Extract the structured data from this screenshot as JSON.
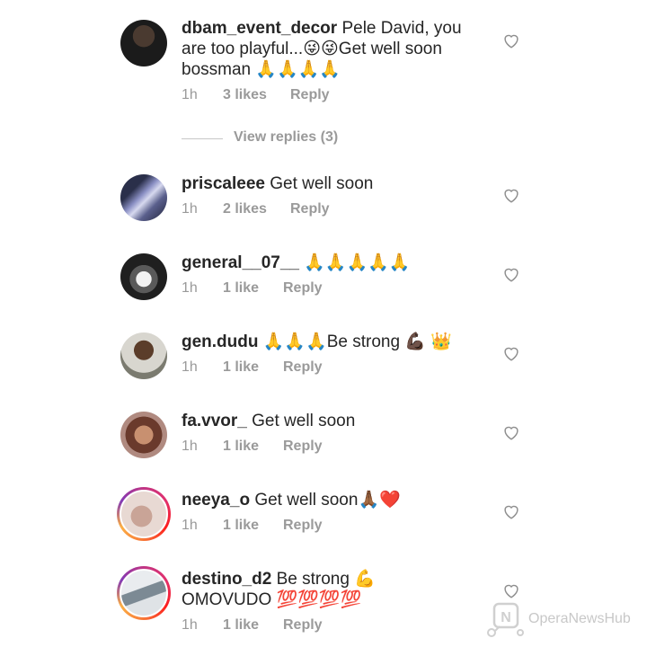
{
  "comments": [
    {
      "username": "dbam_event_decor",
      "text": " Pele David, you are too playful...😜😜Get well soon bossman 🙏🙏🙏🙏",
      "time": "1h",
      "likes": "3 likes",
      "reply": "Reply",
      "view_replies": "View replies (3)"
    },
    {
      "username": "priscaleee",
      "text": " Get well soon ",
      "time": "1h",
      "likes": "2 likes",
      "reply": "Reply"
    },
    {
      "username": "general__07__",
      "text": "  🙏🙏🙏🙏🙏",
      "time": "1h",
      "likes": "1 like",
      "reply": "Reply"
    },
    {
      "username": "gen.dudu",
      "text": " 🙏🙏🙏Be strong 💪🏿 👑",
      "time": "1h",
      "likes": "1 like",
      "reply": "Reply"
    },
    {
      "username": "fa.vvor_",
      "text": " Get well soon",
      "time": "1h",
      "likes": "1 like",
      "reply": "Reply"
    },
    {
      "username": "neeya_o",
      "text": " Get well soon🙏🏾❤️",
      "time": "1h",
      "likes": "1 like",
      "reply": "Reply"
    },
    {
      "username": "destino_d2",
      "text": " Be strong 💪 OMOVUDO 💯💯💯💯",
      "time": "1h",
      "likes": "1 like",
      "reply": "Reply"
    }
  ],
  "watermark": "OperaNewsHub",
  "icons": {
    "like": "heart-outline-icon",
    "watermark_logo": "opera-news-logo"
  },
  "colors": {
    "text": "#262626",
    "meta": "#9a9a9a",
    "heart": "#8e8e8e",
    "story_ring": "#e1306c"
  }
}
